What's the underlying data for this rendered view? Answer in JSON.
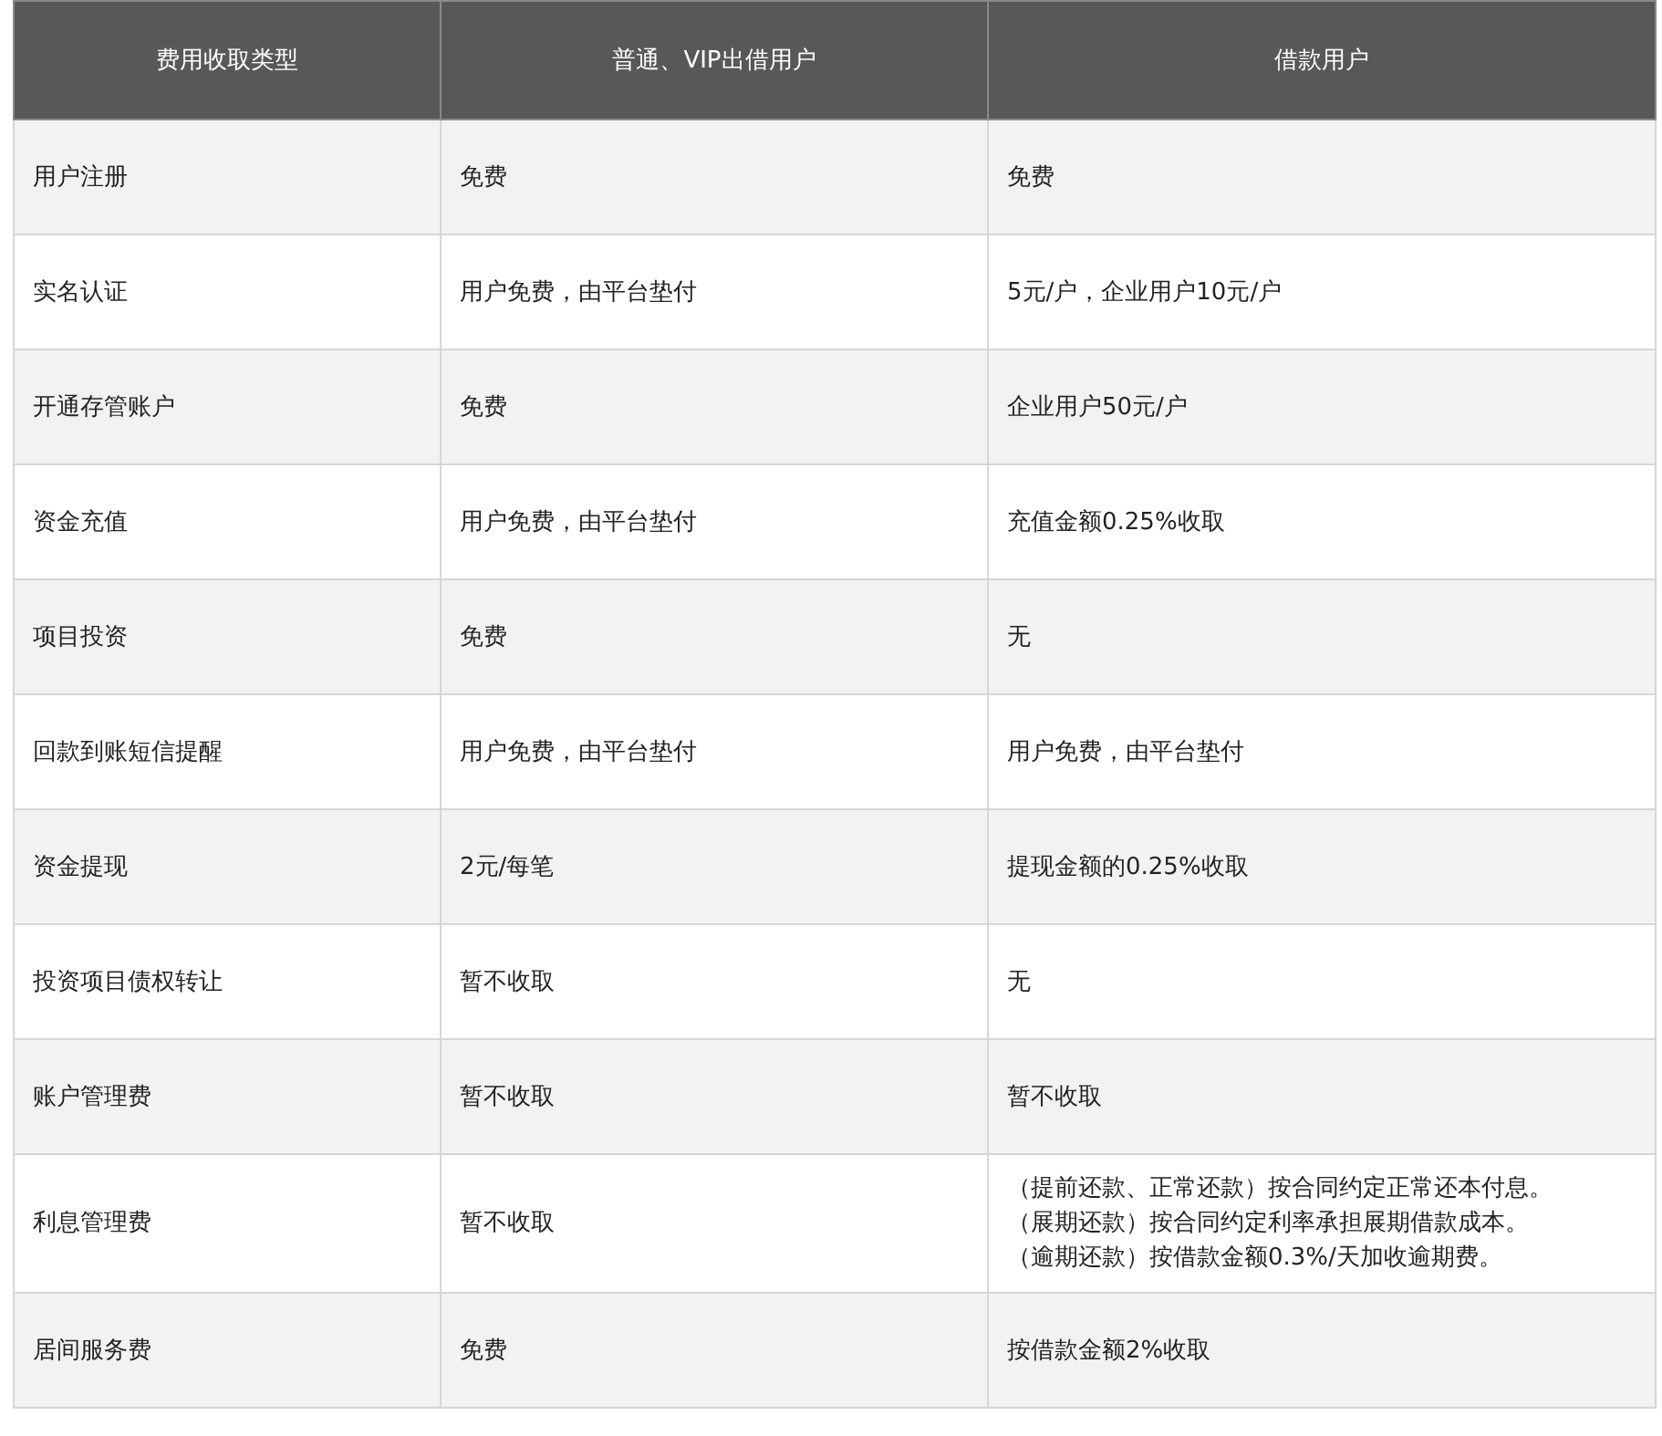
{
  "table": {
    "columns": [
      "费用收取类型",
      "普通、VIP出借用户",
      "借款用户"
    ],
    "rows": [
      [
        "用户注册",
        "免费",
        "免费"
      ],
      [
        "实名认证",
        "用户免费，由平台垫付",
        "5元/户，企业用户10元/户"
      ],
      [
        "开通存管账户",
        "免费",
        "企业用户50元/户"
      ],
      [
        "资金充值",
        "用户免费，由平台垫付",
        "充值金额0.25%收取"
      ],
      [
        "项目投资",
        "免费",
        "无"
      ],
      [
        "回款到账短信提醒",
        "用户免费，由平台垫付",
        "用户免费，由平台垫付"
      ],
      [
        "资金提现",
        "2元/每笔",
        "提现金额的0.25%收取"
      ],
      [
        "投资项目债权转让",
        "暂不收取",
        "无"
      ],
      [
        "账户管理费",
        "暂不收取",
        "暂不收取"
      ],
      [
        "利息管理费",
        "暂不收取",
        [
          "（提前还款、正常还款）按合同约定正常还本付息。",
          "（展期还款）按合同约定利率承担展期借款成本。",
          "（逾期还款）按借款金额0.3%/天加收逾期费。"
        ]
      ],
      [
        "居间服务费",
        "免费",
        "按借款金额2%收取"
      ]
    ]
  }
}
